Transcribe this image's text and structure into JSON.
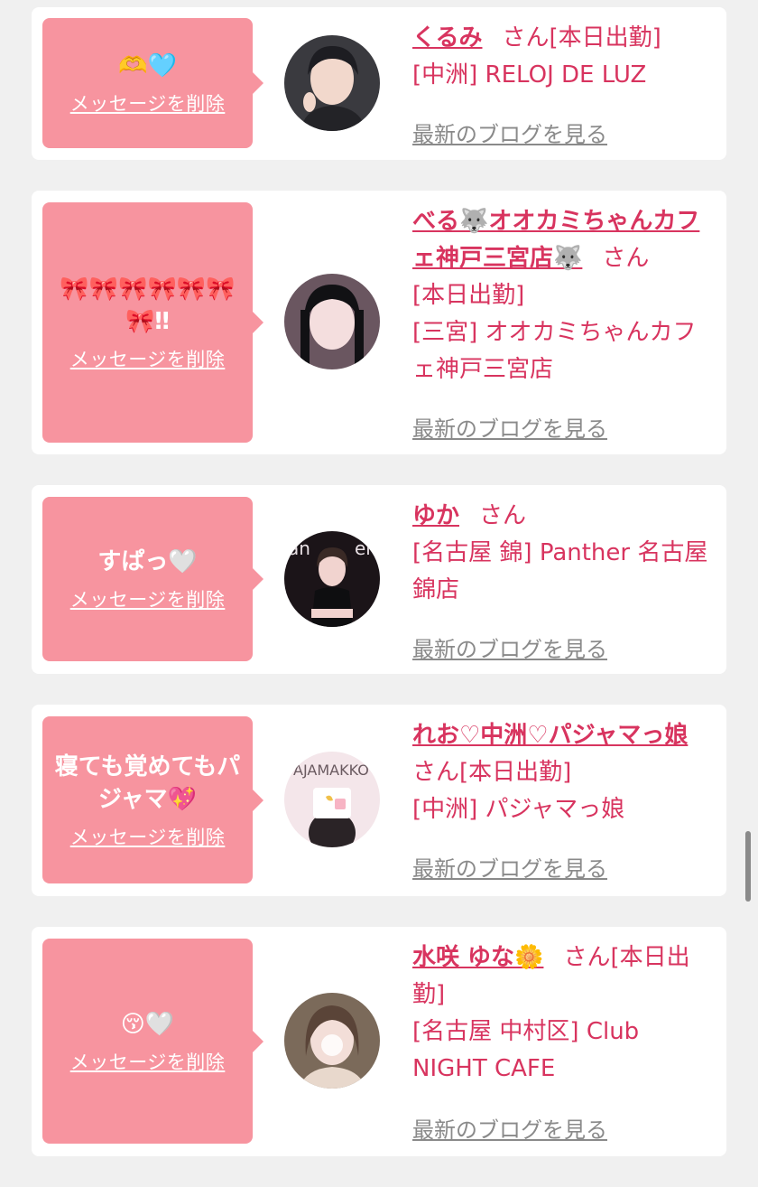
{
  "cards": [
    {
      "message": "🫶🩵",
      "delete_label": "メッセージを削除",
      "name": "くるみ",
      "honorific": "さん",
      "status": "[本日出勤]",
      "shop": "[中洲] RELOJ DE LUZ",
      "blog_label": "最新のブログを見る"
    },
    {
      "message": "🎀🎀🎀🎀🎀🎀🎀‼",
      "delete_label": "メッセージを削除",
      "name": "べる🐺オオカミちゃんカフェ神戸三宮店🐺",
      "honorific": "さん",
      "status": "[本日出勤]",
      "shop": "[三宮] オオカミちゃんカフェ神戸三宮店",
      "blog_label": "最新のブログを見る"
    },
    {
      "message": "すぱっ🤍",
      "delete_label": "メッセージを削除",
      "name": "ゆか",
      "honorific": "さん",
      "status": "",
      "shop": "[名古屋 錦] Panther 名古屋錦店",
      "blog_label": "最新のブログを見る"
    },
    {
      "message": "寝ても覚めてもパジャマ💖",
      "delete_label": "メッセージを削除",
      "name": "れお♡中洲♡パジャマっ娘",
      "honorific": "さん",
      "status": "[本日出勤]",
      "shop": "[中洲] パジャマっ娘",
      "blog_label": "最新のブログを見る"
    },
    {
      "message": "😚🤍",
      "delete_label": "メッセージを削除",
      "name": "水咲 ゆな🌼",
      "honorific": "さん",
      "status": "[本日出勤]",
      "shop": "[名古屋 中村区] Club NIGHT CAFE",
      "blog_label": "最新のブログを見る"
    }
  ],
  "colors": {
    "accent": "#d8345f",
    "bubble": "#f7949f",
    "background": "#f0f0f0",
    "link_gray": "#8a8a8a"
  }
}
